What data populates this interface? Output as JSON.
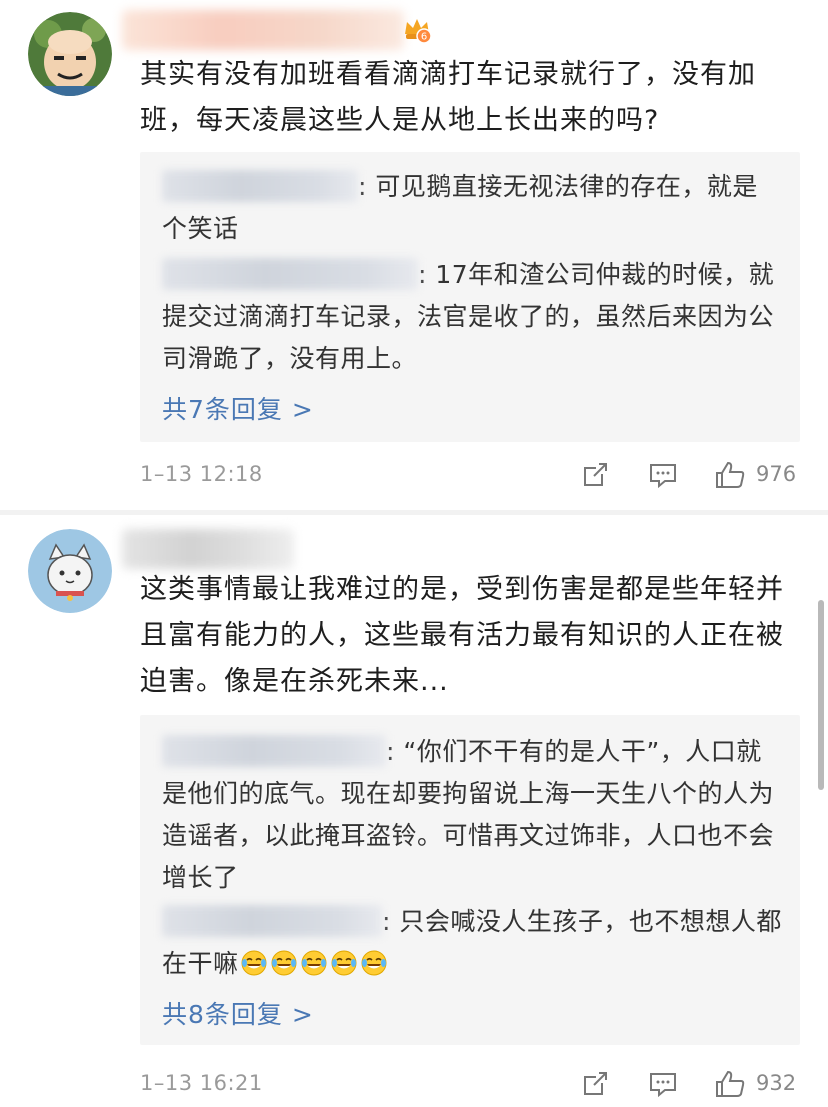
{
  "comments": [
    {
      "text": "其实有没有加班看看滴滴打车记录就行了，没有加班，每天凌晨这些人是从地上长出来的吗?",
      "vip_badge_icon": "vip-crown-icon",
      "vip_badge_level": "6",
      "replies": [
        {
          "text": ": 可见鹅直接无视法律的存在，就是个笑话"
        },
        {
          "text": ": 17年和渣公司仲裁的时候，就提交过滴滴打车记录，法官是收了的，虽然后来因为公司滑跪了，没有用上。"
        }
      ],
      "more_replies": "共7条回复 >",
      "time": "1–13 12:18",
      "like_count": "976"
    },
    {
      "text": "这类事情最让我难过的是，受到伤害是都是些年轻并且富有能力的人，这些最有活力最有知识的人正在被迫害。像是在杀死未来...",
      "replies": [
        {
          "text": ": “你们不干有的是人干”，人口就是他们的底气。现在却要拘留说上海一天生八个的人为造谣者，以此掩耳盗铃。可惜再文过饰非，人口也不会增长了"
        },
        {
          "text": ": 只会喊没人生孩子，也不想想人都在干嘛",
          "emoji": "laughing-crying-emoji",
          "emoji_count": 5
        }
      ],
      "more_replies": "共8条回复 >",
      "time": "1–13 16:21",
      "like_count": "932"
    }
  ],
  "colors": {
    "link": "#4a78b4",
    "reply_bg": "#f5f5f5",
    "meta_text": "#9a9a9a"
  },
  "icons": {
    "share": "share-icon",
    "comment": "comment-icon",
    "like": "thumbs-up-icon"
  }
}
